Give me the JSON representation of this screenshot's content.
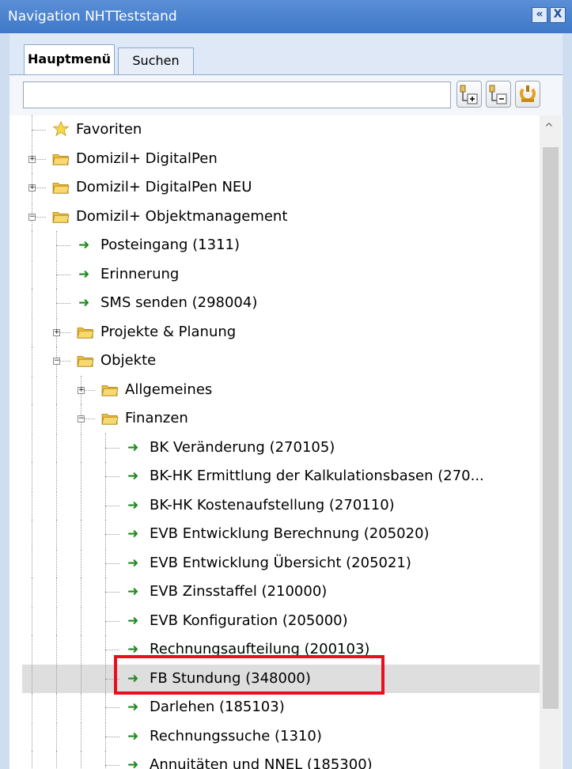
{
  "window": {
    "title": "Navigation NHTTeststand",
    "collapse_label": "«",
    "close_label": "X"
  },
  "tabs": [
    {
      "label": "Hauptmenü",
      "active": true
    },
    {
      "label": "Suchen",
      "active": false
    }
  ],
  "search": {
    "value": "",
    "placeholder": ""
  },
  "toolbar": {
    "buttons": [
      "expand-all-icon",
      "collapse-all-icon",
      "refresh-icon"
    ]
  },
  "tree": {
    "items": [
      {
        "label": "Favoriten",
        "icon": "star-icon",
        "level": 0,
        "expander": "none"
      },
      {
        "label": "Domizil+ DigitalPen",
        "icon": "folder-icon",
        "level": 0,
        "expander": "plus"
      },
      {
        "label": "Domizil+ DigitalPen NEU",
        "icon": "folder-icon",
        "level": 0,
        "expander": "plus"
      },
      {
        "label": "Domizil+ Objektmanagement",
        "icon": "folder-icon",
        "level": 0,
        "expander": "minus"
      },
      {
        "label": "Posteingang (1311)",
        "icon": "arrow-icon",
        "level": 1,
        "expander": "none"
      },
      {
        "label": "Erinnerung",
        "icon": "arrow-icon",
        "level": 1,
        "expander": "none"
      },
      {
        "label": "SMS senden (298004)",
        "icon": "arrow-icon",
        "level": 1,
        "expander": "none"
      },
      {
        "label": "Projekte & Planung",
        "icon": "folder-icon",
        "level": 1,
        "expander": "plus"
      },
      {
        "label": "Objekte",
        "icon": "folder-icon",
        "level": 1,
        "expander": "minus"
      },
      {
        "label": "Allgemeines",
        "icon": "folder-icon",
        "level": 2,
        "expander": "plus"
      },
      {
        "label": "Finanzen",
        "icon": "folder-icon",
        "level": 2,
        "expander": "minus"
      },
      {
        "label": "BK Veränderung (270105)",
        "icon": "arrow-icon",
        "level": 3,
        "expander": "none"
      },
      {
        "label": "BK-HK Ermittlung der Kalkulationsbasen (270...",
        "icon": "arrow-icon",
        "level": 3,
        "expander": "none"
      },
      {
        "label": "BK-HK Kostenaufstellung (270110)",
        "icon": "arrow-icon",
        "level": 3,
        "expander": "none"
      },
      {
        "label": "EVB Entwicklung Berechnung (205020)",
        "icon": "arrow-icon",
        "level": 3,
        "expander": "none"
      },
      {
        "label": "EVB Entwicklung Übersicht (205021)",
        "icon": "arrow-icon",
        "level": 3,
        "expander": "none"
      },
      {
        "label": "EVB Zinsstaffel (210000)",
        "icon": "arrow-icon",
        "level": 3,
        "expander": "none"
      },
      {
        "label": "EVB Konfiguration (205000)",
        "icon": "arrow-icon",
        "level": 3,
        "expander": "none"
      },
      {
        "label": "Rechnungsaufteilung (200103)",
        "icon": "arrow-icon",
        "level": 3,
        "expander": "none"
      },
      {
        "label": "FB Stundung (348000)",
        "icon": "arrow-icon",
        "level": 3,
        "expander": "none",
        "selected": true
      },
      {
        "label": "Darlehen (185103)",
        "icon": "arrow-icon",
        "level": 3,
        "expander": "none"
      },
      {
        "label": "Rechnungssuche (1310)",
        "icon": "arrow-icon",
        "level": 3,
        "expander": "none"
      },
      {
        "label": "Annuitäten und NNEL (185300)",
        "icon": "arrow-icon",
        "level": 3,
        "expander": "none"
      }
    ]
  },
  "colors": {
    "titlebar": "#4a82cf",
    "selected_row": "#dedede",
    "arrow": "#1e8a1e",
    "highlight_box": "#e8101f",
    "folder": "#f5c542"
  }
}
